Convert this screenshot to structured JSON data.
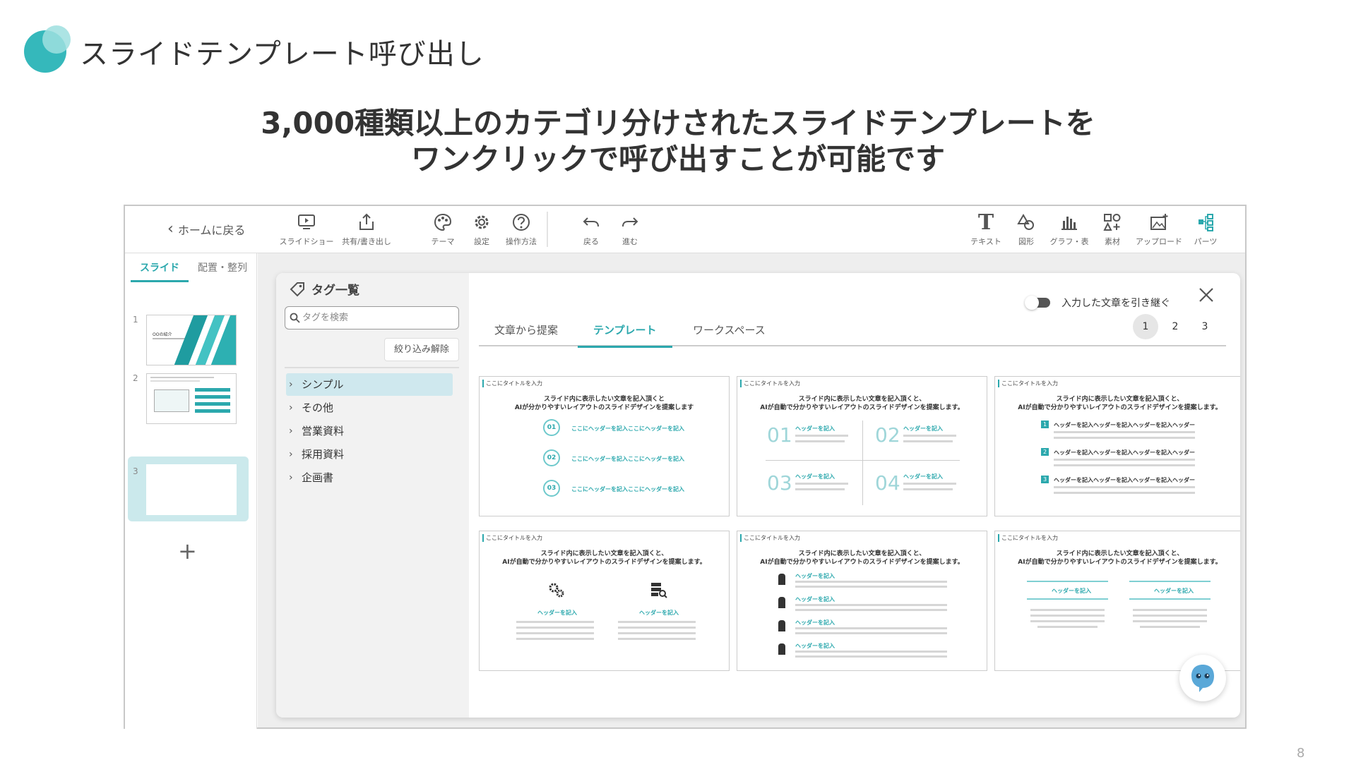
{
  "page": {
    "title": "スライドテンプレート呼び出し",
    "headline_line1": "3,000種類以上のカテゴリ分けされたスライドテンプレートを",
    "headline_line2": "ワンクリックで呼び出すことが可能です",
    "page_number": "8",
    "colors": {
      "accent": "#2ba8ad",
      "logo_main": "#35b8bb",
      "logo_light": "#9edfdf"
    }
  },
  "toolbar": {
    "back_label": "ホームに戻る",
    "left_items": [
      {
        "label": "スライドショー",
        "icon": "monitor-play-icon"
      },
      {
        "label": "共有/書き出し",
        "icon": "share-upload-icon"
      },
      {
        "label": "テーマ",
        "icon": "palette-icon"
      },
      {
        "label": "設定",
        "icon": "gear-icon"
      },
      {
        "label": "操作方法",
        "icon": "help-icon"
      },
      {
        "label": "戻る",
        "icon": "undo-icon"
      },
      {
        "label": "進む",
        "icon": "redo-icon"
      }
    ],
    "right_items": [
      {
        "label": "テキスト",
        "icon": "text-icon"
      },
      {
        "label": "図形",
        "icon": "shapes-icon"
      },
      {
        "label": "グラフ・表",
        "icon": "chart-icon"
      },
      {
        "label": "素材",
        "icon": "materials-icon"
      },
      {
        "label": "アップロード",
        "icon": "image-upload-icon"
      },
      {
        "label": "パーツ",
        "icon": "parts-icon"
      }
    ]
  },
  "left_panel": {
    "tabs": [
      "スライド",
      "配置・整列"
    ],
    "active_tab": "スライド",
    "slides": [
      {
        "number": "1",
        "title": "OOの紹介"
      },
      {
        "number": "2"
      },
      {
        "number": "3"
      }
    ],
    "selected_slide": "3",
    "add_label": "+"
  },
  "tag_panel": {
    "title": "タグ一覧",
    "search_placeholder": "タグを検索",
    "clear_button": "絞り込み解除",
    "tags": [
      "シンプル",
      "その他",
      "営業資料",
      "採用資料",
      "企画書"
    ],
    "active_tag": "シンプル"
  },
  "content": {
    "toggle_label": "入力した文章を引き継ぐ",
    "toggle_on": false,
    "tabs": [
      "文章から提案",
      "テンプレート",
      "ワークスペース"
    ],
    "active_tab": "テンプレート",
    "pages": [
      "1",
      "2",
      "3"
    ],
    "current_page": "1",
    "templates": [
      {
        "title": "ここにタイトルを入力",
        "sub1": "スライド内に表示したい文章を記入頂くと",
        "sub2": "AIが分かりやすいレイアウトのスライドデザインを提案します",
        "layout": "numbered-rings",
        "items": [
          "01",
          "02",
          "03"
        ],
        "item_text": "ここにヘッダーを記入ここにヘッダーを記入"
      },
      {
        "title": "ここにタイトルを入力",
        "sub1": "スライド内に表示したい文章を記入頂くと、",
        "sub2": "AIが自動で分かりやすいレイアウトのスライドデザインを提案します。",
        "layout": "grid-2x2",
        "items": [
          "01",
          "02",
          "03",
          "04"
        ],
        "item_text": "ヘッダーを記入"
      },
      {
        "title": "ここにタイトルを入力",
        "sub1": "スライド内に表示したい文章を記入頂くと、",
        "sub2": "AIが自動で分かりやすいレイアウトのスライドデザインを提案します。",
        "layout": "numbered-list",
        "items": [
          "1",
          "2",
          "3"
        ],
        "item_text": "ヘッダーを記入ヘッダーを記入ヘッダーを記入ヘッダー"
      },
      {
        "title": "ここにタイトルを入力",
        "sub1": "スライド内に表示したい文章を記入頂くと、",
        "sub2": "AIが自動で分かりやすいレイアウトのスライドデザインを提案します。",
        "layout": "two-icons",
        "item_text": "ヘッダーを記入"
      },
      {
        "title": "ここにタイトルを入力",
        "sub1": "スライド内に表示したい文章を記入頂くと、",
        "sub2": "AIが自動で分かりやすいレイアウトのスライドデザインを提案します。",
        "layout": "icon-rows",
        "item_text": "ヘッダーを記入"
      },
      {
        "title": "ここにタイトルを入力",
        "sub1": "スライド内に表示したい文章を記入頂くと、",
        "sub2": "AIが自動で分かりやすいレイアウトのスライドデザインを提案します。",
        "layout": "two-columns",
        "item_text": "ヘッダーを記入"
      }
    ]
  }
}
